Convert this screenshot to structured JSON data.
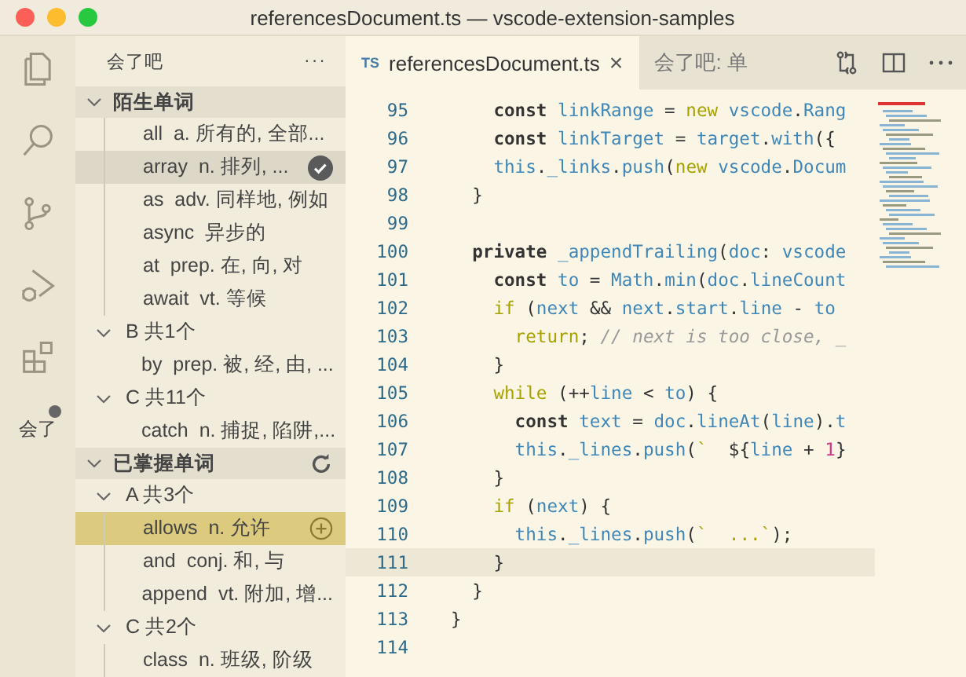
{
  "window": {
    "title": "referencesDocument.ts — vscode-extension-samples"
  },
  "activity_bar": {
    "items": [
      {
        "kind": "files",
        "selected": false
      },
      {
        "kind": "search",
        "selected": false
      },
      {
        "kind": "source-control",
        "selected": false
      },
      {
        "kind": "debug",
        "selected": false
      },
      {
        "kind": "extensions",
        "selected": false
      },
      {
        "kind": "text",
        "label": "会了",
        "badge": true,
        "selected": true
      }
    ]
  },
  "sidebar": {
    "title": "会了吧",
    "more": "···",
    "sections": [
      {
        "label": "陌生单词",
        "expanded": true,
        "children": [
          {
            "kind": "word",
            "word": "all",
            "meaning": "a. 所有的, 全部...",
            "selected": false,
            "hovered": false
          },
          {
            "kind": "word",
            "word": "array",
            "meaning": "n. 排列, ...",
            "selected": false,
            "hovered": true,
            "buttons": [
              {
                "kind": "check"
              }
            ]
          },
          {
            "kind": "word",
            "word": "as",
            "meaning": "adv. 同样地, 例如",
            "selected": false,
            "hovered": false
          },
          {
            "kind": "word",
            "word": "async",
            "meaning": "异步的",
            "selected": false,
            "hovered": false
          },
          {
            "kind": "word",
            "word": "at",
            "meaning": "prep. 在, 向, 对",
            "selected": false,
            "hovered": false
          },
          {
            "kind": "word",
            "word": "await",
            "meaning": "vt. 等候",
            "selected": false,
            "hovered": false
          },
          {
            "kind": "group",
            "label": "B  共1个",
            "expanded": true,
            "children": [
              {
                "kind": "word",
                "word": "by",
                "meaning": "prep. 被, 经, 由, ...",
                "selected": false,
                "hovered": false
              }
            ]
          },
          {
            "kind": "group",
            "label": "C  共11个",
            "expanded": true,
            "children": [
              {
                "kind": "word",
                "word": "catch",
                "meaning": "n. 捕捉, 陷阱,...",
                "selected": false,
                "hovered": false
              }
            ]
          }
        ]
      },
      {
        "label": "已掌握单词",
        "expanded": true,
        "buttons": [
          {
            "kind": "refresh"
          }
        ],
        "children": [
          {
            "kind": "group",
            "label": "A  共3个",
            "expanded": true,
            "children": [
              {
                "kind": "word",
                "word": "allows",
                "meaning": "n. 允许",
                "selected": true,
                "hovered": false,
                "buttons": [
                  {
                    "kind": "add"
                  }
                ]
              },
              {
                "kind": "word",
                "word": "and",
                "meaning": "conj. 和, 与",
                "selected": false,
                "hovered": false
              },
              {
                "kind": "word",
                "word": "append",
                "meaning": "vt. 附加, 增...",
                "selected": false,
                "hovered": false
              }
            ]
          },
          {
            "kind": "group",
            "label": "C  共2个",
            "expanded": true,
            "children": [
              {
                "kind": "word",
                "word": "class",
                "meaning": "n. 班级, 阶级",
                "selected": false,
                "hovered": false
              }
            ]
          }
        ]
      }
    ]
  },
  "tabs": [
    {
      "badge": "TS",
      "label": "referencesDocument.ts",
      "close": "×",
      "selected": true
    },
    {
      "label": "会了吧: 单",
      "selected": false
    }
  ],
  "editor": {
    "lines": [
      {
        "num": "95",
        "current": false,
        "tokens": [
          {
            "kind": "kw",
            "text": "    const"
          },
          {
            "kind": "v",
            "text": " linkRange"
          },
          {
            "kind": "p",
            "text": " = "
          },
          {
            "kind": "ctl",
            "text": "new"
          },
          {
            "kind": "v",
            "text": " vscode"
          },
          {
            "kind": "p",
            "text": "."
          },
          {
            "kind": "v",
            "text": "Rang"
          }
        ]
      },
      {
        "num": "96",
        "current": false,
        "tokens": [
          {
            "kind": "kw",
            "text": "    const"
          },
          {
            "kind": "v",
            "text": " linkTarget"
          },
          {
            "kind": "p",
            "text": " = "
          },
          {
            "kind": "v",
            "text": "target"
          },
          {
            "kind": "p",
            "text": "."
          },
          {
            "kind": "v",
            "text": "with"
          },
          {
            "kind": "p",
            "text": "({"
          }
        ]
      },
      {
        "num": "97",
        "current": false,
        "tokens": [
          {
            "kind": "v",
            "text": "    this"
          },
          {
            "kind": "p",
            "text": "."
          },
          {
            "kind": "v",
            "text": "_links"
          },
          {
            "kind": "p",
            "text": "."
          },
          {
            "kind": "v",
            "text": "push"
          },
          {
            "kind": "p",
            "text": "("
          },
          {
            "kind": "ctl",
            "text": "new"
          },
          {
            "kind": "v",
            "text": " vscode"
          },
          {
            "kind": "p",
            "text": "."
          },
          {
            "kind": "v",
            "text": "Docum"
          }
        ]
      },
      {
        "num": "98",
        "current": false,
        "tokens": [
          {
            "kind": "p",
            "text": "  }"
          }
        ]
      },
      {
        "num": "99",
        "current": false
      },
      {
        "num": "100",
        "current": false,
        "tokens": [
          {
            "kind": "kw",
            "text": "  private"
          },
          {
            "kind": "v",
            "text": " _appendTrailing"
          },
          {
            "kind": "p",
            "text": "("
          },
          {
            "kind": "v",
            "text": "doc"
          },
          {
            "kind": "p",
            "text": ": "
          },
          {
            "kind": "v",
            "text": "vscode"
          }
        ]
      },
      {
        "num": "101",
        "current": false,
        "tokens": [
          {
            "kind": "kw",
            "text": "    const"
          },
          {
            "kind": "v",
            "text": " to"
          },
          {
            "kind": "p",
            "text": " = "
          },
          {
            "kind": "v",
            "text": "Math"
          },
          {
            "kind": "p",
            "text": "."
          },
          {
            "kind": "v",
            "text": "min"
          },
          {
            "kind": "p",
            "text": "("
          },
          {
            "kind": "v",
            "text": "doc"
          },
          {
            "kind": "p",
            "text": "."
          },
          {
            "kind": "v",
            "text": "lineCount"
          }
        ]
      },
      {
        "num": "102",
        "current": false,
        "tokens": [
          {
            "kind": "ctl",
            "text": "    if"
          },
          {
            "kind": "p",
            "text": " ("
          },
          {
            "kind": "v",
            "text": "next"
          },
          {
            "kind": "p",
            "text": " && "
          },
          {
            "kind": "v",
            "text": "next"
          },
          {
            "kind": "p",
            "text": "."
          },
          {
            "kind": "v",
            "text": "start"
          },
          {
            "kind": "p",
            "text": "."
          },
          {
            "kind": "v",
            "text": "line"
          },
          {
            "kind": "p",
            "text": " - "
          },
          {
            "kind": "v",
            "text": "to"
          }
        ]
      },
      {
        "num": "103",
        "current": false,
        "tokens": [
          {
            "kind": "ctl",
            "text": "      return"
          },
          {
            "kind": "p",
            "text": ";"
          },
          {
            "kind": "c",
            "text": " // next is too close, _"
          }
        ]
      },
      {
        "num": "104",
        "current": false,
        "tokens": [
          {
            "kind": "p",
            "text": "    }"
          }
        ]
      },
      {
        "num": "105",
        "current": false,
        "tokens": [
          {
            "kind": "ctl",
            "text": "    while"
          },
          {
            "kind": "p",
            "text": " (++"
          },
          {
            "kind": "v",
            "text": "line"
          },
          {
            "kind": "p",
            "text": " < "
          },
          {
            "kind": "v",
            "text": "to"
          },
          {
            "kind": "p",
            "text": ") {"
          }
        ]
      },
      {
        "num": "106",
        "current": false,
        "tokens": [
          {
            "kind": "kw",
            "text": "      const"
          },
          {
            "kind": "v",
            "text": " text"
          },
          {
            "kind": "p",
            "text": " = "
          },
          {
            "kind": "v",
            "text": "doc"
          },
          {
            "kind": "p",
            "text": "."
          },
          {
            "kind": "v",
            "text": "lineAt"
          },
          {
            "kind": "p",
            "text": "("
          },
          {
            "kind": "v",
            "text": "line"
          },
          {
            "kind": "p",
            "text": ")."
          },
          {
            "kind": "v",
            "text": "t"
          }
        ]
      },
      {
        "num": "107",
        "current": false,
        "tokens": [
          {
            "kind": "v",
            "text": "      this"
          },
          {
            "kind": "p",
            "text": "."
          },
          {
            "kind": "v",
            "text": "_lines"
          },
          {
            "kind": "p",
            "text": "."
          },
          {
            "kind": "v",
            "text": "push"
          },
          {
            "kind": "p",
            "text": "("
          },
          {
            "kind": "s",
            "text": "`  "
          },
          {
            "kind": "p",
            "text": "${"
          },
          {
            "kind": "v",
            "text": "line"
          },
          {
            "kind": "p",
            "text": " + "
          },
          {
            "kind": "n",
            "text": "1"
          },
          {
            "kind": "p",
            "text": "}"
          }
        ]
      },
      {
        "num": "108",
        "current": false,
        "tokens": [
          {
            "kind": "p",
            "text": "    }"
          }
        ]
      },
      {
        "num": "109",
        "current": false,
        "tokens": [
          {
            "kind": "ctl",
            "text": "    if"
          },
          {
            "kind": "p",
            "text": " ("
          },
          {
            "kind": "v",
            "text": "next"
          },
          {
            "kind": "p",
            "text": ") {"
          }
        ]
      },
      {
        "num": "110",
        "current": false,
        "tokens": [
          {
            "kind": "v",
            "text": "      this"
          },
          {
            "kind": "p",
            "text": "."
          },
          {
            "kind": "v",
            "text": "_lines"
          },
          {
            "kind": "p",
            "text": "."
          },
          {
            "kind": "v",
            "text": "push"
          },
          {
            "kind": "p",
            "text": "("
          },
          {
            "kind": "s",
            "text": "`  ...`"
          },
          {
            "kind": "p",
            "text": ");"
          }
        ]
      },
      {
        "num": "111",
        "current": true,
        "tokens": [
          {
            "kind": "p",
            "text": "    }"
          }
        ]
      },
      {
        "num": "112",
        "current": false,
        "tokens": [
          {
            "kind": "p",
            "text": "  }"
          }
        ]
      },
      {
        "num": "113",
        "current": false,
        "tokens": [
          {
            "kind": "p",
            "text": "}"
          }
        ]
      },
      {
        "num": "114",
        "current": false
      }
    ]
  }
}
